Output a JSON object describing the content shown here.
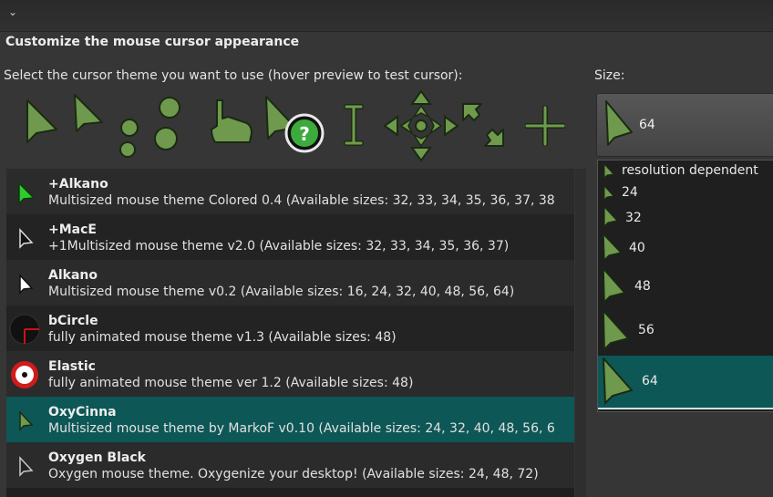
{
  "header": {
    "collapse_glyph": "⌄",
    "title": "Customize the mouse cursor appearance",
    "instruction": "Select the cursor theme you want to use (hover preview to test cursor):",
    "size_label": "Size:"
  },
  "preview": {
    "help_glyph": "?",
    "icons": [
      "arrow-cursor-icon",
      "pointing-arrow-cursor-icon",
      "busy-dots-icon",
      "hand-cursor-icon",
      "help-cursor-icon",
      "text-beam-icon",
      "move-arrows-icon",
      "diagonal-resize-icon",
      "crosshair-icon"
    ],
    "cursor_color": "#6f9a4e",
    "outline_color": "#1a2a12"
  },
  "themes": [
    {
      "name": "+Alkano",
      "description": "Multisized mouse theme Colored 0.4 (Available sizes: 32, 33, 34, 35, 36, 37, 38",
      "icon": "green-arrow-icon",
      "selected": false
    },
    {
      "name": "+MacE",
      "description": "+1Multisized mouse theme v2.0 (Available sizes: 32, 33, 34, 35, 36, 37)",
      "icon": "black-arrow-icon",
      "selected": false
    },
    {
      "name": "Alkano",
      "description": "Multisized mouse theme v0.2 (Available sizes: 16, 24, 32, 40, 48, 56, 64)",
      "icon": "white-arrow-icon",
      "selected": false
    },
    {
      "name": "bCircle",
      "description": "fully animated mouse theme v1.3 (Available sizes: 48)",
      "icon": "dark-circle-crosshair-icon",
      "selected": false
    },
    {
      "name": "Elastic",
      "description": "fully animated mouse theme ver 1.2 (Available sizes: 48)",
      "icon": "red-ring-target-icon",
      "selected": false
    },
    {
      "name": "OxyCinna",
      "description": "Multisized mouse theme by MarkoF v0.10 (Available sizes: 24, 32, 40, 48, 56, 6",
      "icon": "olive-arrow-icon",
      "selected": true
    },
    {
      "name": "Oxygen Black",
      "description": "Oxygen mouse theme. Oxygenize your desktop! (Available sizes: 24, 48, 72)",
      "icon": "gray-arrow-icon",
      "selected": false
    }
  ],
  "size": {
    "current": "64",
    "options": [
      {
        "label": "resolution dependent",
        "selected": false
      },
      {
        "label": "24",
        "selected": false
      },
      {
        "label": "32",
        "selected": false
      },
      {
        "label": "40",
        "selected": false
      },
      {
        "label": "48",
        "selected": false
      },
      {
        "label": "56",
        "selected": false
      },
      {
        "label": "64",
        "selected": true
      }
    ]
  },
  "colors": {
    "selection": "#0d5757",
    "cursor_green": "#6f9a4e",
    "bright_green": "#2ecc2e"
  }
}
